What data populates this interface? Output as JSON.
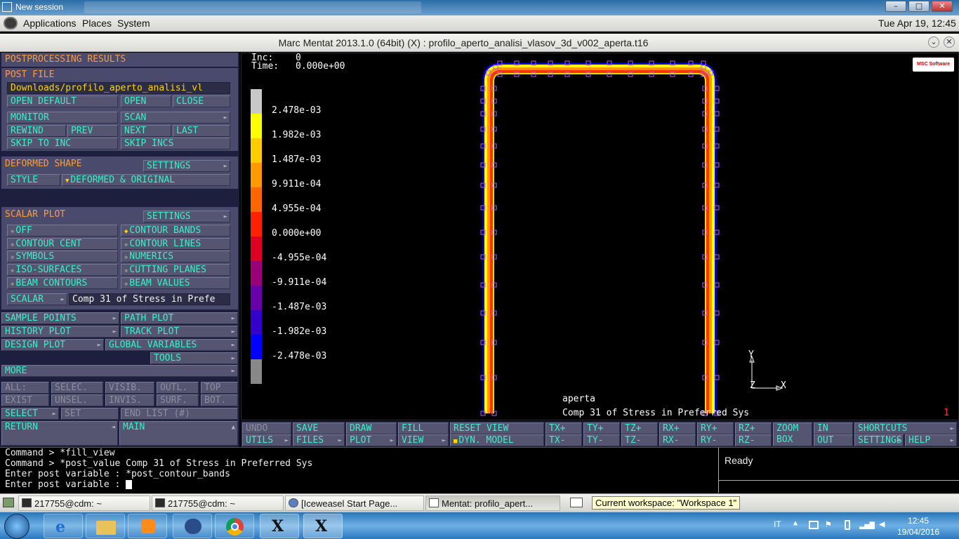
{
  "xwindow": {
    "title": "New session"
  },
  "gnome_menu": {
    "applications": "Applications",
    "places": "Places",
    "system": "System",
    "clock": "Tue Apr 19, 12:45"
  },
  "window": {
    "title": "Marc Mentat 2013.1.0 (64bit) (X) : profilo_aperto_analisi_vlasov_3d_v002_aperta.t16"
  },
  "left_panel": {
    "title": "POSTPROCESSING RESULTS",
    "post_file": {
      "header": "POST FILE",
      "path": "Downloads/profilo_aperto_analisi_vl",
      "open_default": "OPEN DEFAULT",
      "open": "OPEN",
      "close": "CLOSE",
      "monitor": "MONITOR",
      "scan": "SCAN",
      "rewind": "REWIND",
      "prev": "PREV",
      "next": "NEXT",
      "last": "LAST",
      "skip_to_inc": "SKIP TO INC",
      "skip_incs": "SKIP INCS"
    },
    "deformed_shape": {
      "header": "DEFORMED SHAPE",
      "settings": "SETTINGS",
      "style": "STYLE",
      "style_value": "DEFORMED & ORIGINAL"
    },
    "scalar_plot": {
      "header": "SCALAR PLOT",
      "settings": "SETTINGS",
      "off": "OFF",
      "contour_bands": "CONTOUR BANDS",
      "contour_cent": "CONTOUR CENT",
      "contour_lines": "CONTOUR LINES",
      "symbols": "SYMBOLS",
      "numerics": "NUMERICS",
      "iso_surfaces": "ISO-SURFACES",
      "cutting_planes": "CUTTING PLANES",
      "beam_contours": "BEAM CONTOURS",
      "beam_values": "BEAM VALUES",
      "scalar": "SCALAR",
      "scalar_value": "Comp 31 of Stress in Prefe"
    },
    "sample_points": "SAMPLE POINTS",
    "path_plot": "PATH PLOT",
    "history_plot": "HISTORY PLOT",
    "track_plot": "TRACK PLOT",
    "design_plot": "DESIGN PLOT",
    "global_variables": "GLOBAL VARIABLES",
    "tools": "TOOLS",
    "more": "MORE",
    "selection": {
      "all": "ALL:",
      "selec": "SELEC.",
      "visib": "VISIB.",
      "outl": "OUTL.",
      "top": "TOP",
      "exist": "EXIST",
      "unsel": "UNSEL.",
      "invis": "INVIS.",
      "surf": "SURF.",
      "bot": "BOT.",
      "select": "SELECT",
      "set": "SET",
      "end_list": "END LIST (#)"
    },
    "return": "RETURN",
    "main": "MAIN"
  },
  "viewport": {
    "inc_label": "Inc:",
    "inc_value": "0",
    "time_label": "Time:",
    "time_value": "0.000e+00",
    "model_name": "aperta",
    "scalar_name": "Comp 31 of Stress in Preferred Sys",
    "page": "1",
    "logo": "MSC Software",
    "axis_y": "Y",
    "axis_x": "X",
    "axis_z": "Z"
  },
  "legend": {
    "values": [
      "2.478e-03",
      "1.982e-03",
      "1.487e-03",
      "9.911e-04",
      "4.955e-04",
      "0.000e+00",
      "-4.955e-04",
      "-9.911e-04",
      "-1.487e-03",
      "-1.982e-03",
      "-2.478e-03"
    ],
    "colors": [
      "#c8c8c8",
      "#ffff00",
      "#ffcc00",
      "#ff9900",
      "#ff6600",
      "#ff2200",
      "#dd0022",
      "#990077",
      "#6600aa",
      "#3300cc",
      "#0000ff",
      "#888888"
    ]
  },
  "toolbar": {
    "undo": "UNDO",
    "save": "SAVE",
    "draw": "DRAW",
    "fill": "FILL",
    "reset_view": "RESET VIEW",
    "tx_plus": "TX+",
    "ty_plus": "TY+",
    "tz_plus": "TZ+",
    "rx_plus": "RX+",
    "ry_plus": "RY+",
    "rz_plus": "RZ+",
    "zoom": "ZOOM",
    "box": "BOX",
    "in": "IN",
    "out": "OUT",
    "shortcuts": "SHORTCUTS",
    "utils": "UTILS",
    "files": "FILES",
    "plot": "PLOT",
    "view": "VIEW",
    "dyn_model": "DYN. MODEL",
    "tx_minus": "TX-",
    "ty_minus": "TY-",
    "tz_minus": "TZ-",
    "rx_minus": "RX-",
    "ry_minus": "RY-",
    "rz_minus": "RZ-",
    "settings": "SETTINGS",
    "help": "HELP"
  },
  "command_lines": [
    "Command > *fill_view",
    "Command > *post_value Comp 31 of Stress in Preferred Sys",
    "Enter post variable : *post_contour_bands",
    "Enter post variable : "
  ],
  "status": "Ready",
  "gnome_panel": {
    "tasks": [
      "217755@cdm: ~",
      "217755@cdm: ~",
      "[Iceweasel Start Page...",
      "Mentat: profilo_apert..."
    ],
    "tooltip": "Current workspace: \"Workspace 1\""
  },
  "windows_taskbar": {
    "lang": "IT",
    "time": "12:45",
    "date": "19/04/2016"
  }
}
